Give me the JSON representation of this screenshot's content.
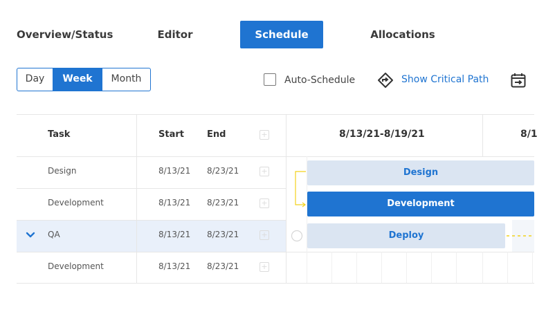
{
  "tabs": [
    {
      "label": "Overview/Status"
    },
    {
      "label": "Editor"
    },
    {
      "label": "Schedule"
    },
    {
      "label": "Allocations"
    }
  ],
  "view_toggle": {
    "day": "Day",
    "week": "Week",
    "month": "Month",
    "selected": "Week"
  },
  "auto_schedule": {
    "label": "Auto-Schedule",
    "checked": false
  },
  "critical_path": {
    "label": "Show Critical Path"
  },
  "table": {
    "headers": {
      "task": "Task",
      "start": "Start",
      "end": "End"
    },
    "rows": [
      {
        "task": "Design",
        "start": "8/13/21",
        "end": "8/23/21"
      },
      {
        "task": "Development",
        "start": "8/13/21",
        "end": "8/23/21"
      },
      {
        "task": "QA",
        "start": "8/13/21",
        "end": "8/23/21",
        "expanded": true
      },
      {
        "task": "Development",
        "start": "8/13/21",
        "end": "8/23/21"
      }
    ]
  },
  "timeline": {
    "weeks": [
      "8/13/21-8/19/21",
      "8/1"
    ],
    "bars": [
      {
        "label": "Design"
      },
      {
        "label": "Development"
      },
      {
        "label": "Deploy"
      }
    ]
  },
  "colors": {
    "accent": "#1f74d1",
    "bar_light": "#dbe5f2",
    "selected_row": "#e9f0fa",
    "dependency": "#f2d21b"
  }
}
